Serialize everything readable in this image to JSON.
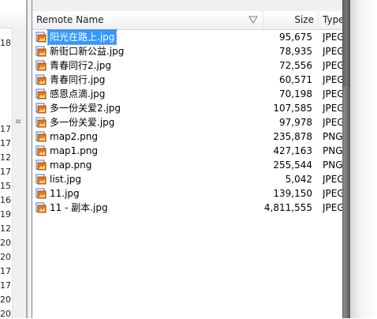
{
  "left_pane": {
    "row_numbers": [
      "18",
      "17",
      "17",
      "12",
      "17",
      "15",
      "16",
      "19",
      "12",
      "20",
      "20",
      "17",
      "17",
      "20",
      "20"
    ]
  },
  "columns": {
    "name": "Remote Name",
    "size": "Size",
    "type": "Type"
  },
  "files": [
    {
      "name": "阳光在路上.jpg",
      "size": "95,675",
      "type": "JPEG",
      "selected": true
    },
    {
      "name": "新街口新公益.jpg",
      "size": "78,935",
      "type": "JPEG"
    },
    {
      "name": "青春同行2.jpg",
      "size": "72,556",
      "type": "JPEG"
    },
    {
      "name": "青春同行.jpg",
      "size": "60,571",
      "type": "JPEG"
    },
    {
      "name": "感恩点滴.jpg",
      "size": "70,198",
      "type": "JPEG"
    },
    {
      "name": "多一份关爱2.jpg",
      "size": "107,585",
      "type": "JPEG"
    },
    {
      "name": "多一份关爱.jpg",
      "size": "97,978",
      "type": "JPEG"
    },
    {
      "name": "map2.png",
      "size": "235,878",
      "type": "PNG"
    },
    {
      "name": "map1.png",
      "size": "427,163",
      "type": "PNG"
    },
    {
      "name": "map.png",
      "size": "255,544",
      "type": "PNG"
    },
    {
      "name": "list.jpg",
      "size": "5,042",
      "type": "JPEG"
    },
    {
      "name": "11.jpg",
      "size": "139,150",
      "type": "JPEG"
    },
    {
      "name": "11 - 副本.jpg",
      "size": "4,811,555",
      "type": "JPEG"
    }
  ],
  "colors": {
    "selection": "#3399ff",
    "icon_orange": "#e07a1f",
    "icon_blue": "#3b6fd6"
  }
}
